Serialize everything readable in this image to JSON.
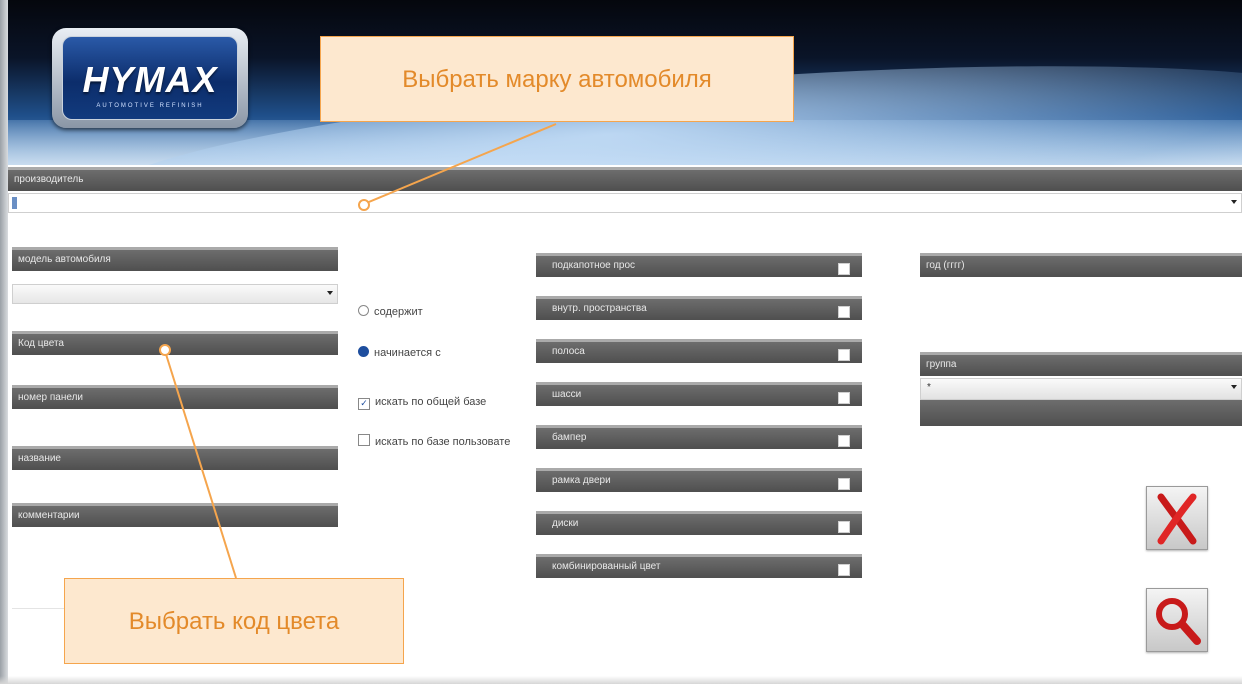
{
  "logo": {
    "text": "HYMAX",
    "tagline": "AUTOMOTIVE REFINISH"
  },
  "manufacturer": {
    "label": "производитель",
    "value": ""
  },
  "left": {
    "model_label": "модель автомобиля",
    "color_code_label": "Код цвета",
    "panel_number_label": "номер панели",
    "name_label": "название",
    "comments_label": "комментарии"
  },
  "options": {
    "contains": "содержит",
    "starts_with": "начинается с",
    "search_common": "искать по общей базе",
    "search_user": "искать по базе пользовате",
    "selected": "starts_with"
  },
  "features": [
    "подкапотное прос",
    "внутр. пространства",
    "полоса",
    "шасси",
    "бампер",
    "рамка двери",
    "диски",
    "комбинированный цвет"
  ],
  "right": {
    "year_label": "год (гггг)",
    "group_label": "группа",
    "group_value": "*"
  },
  "callouts": {
    "make": "Выбрать марку автомобиля",
    "color": "Выбрать код цвета"
  },
  "buttons": {
    "cancel_icon": "close-x-icon",
    "search_icon": "magnifier-icon"
  },
  "colors": {
    "accent": "#f5a54d",
    "bar": "#5a5a5a",
    "cancel": "#d01f1f"
  }
}
